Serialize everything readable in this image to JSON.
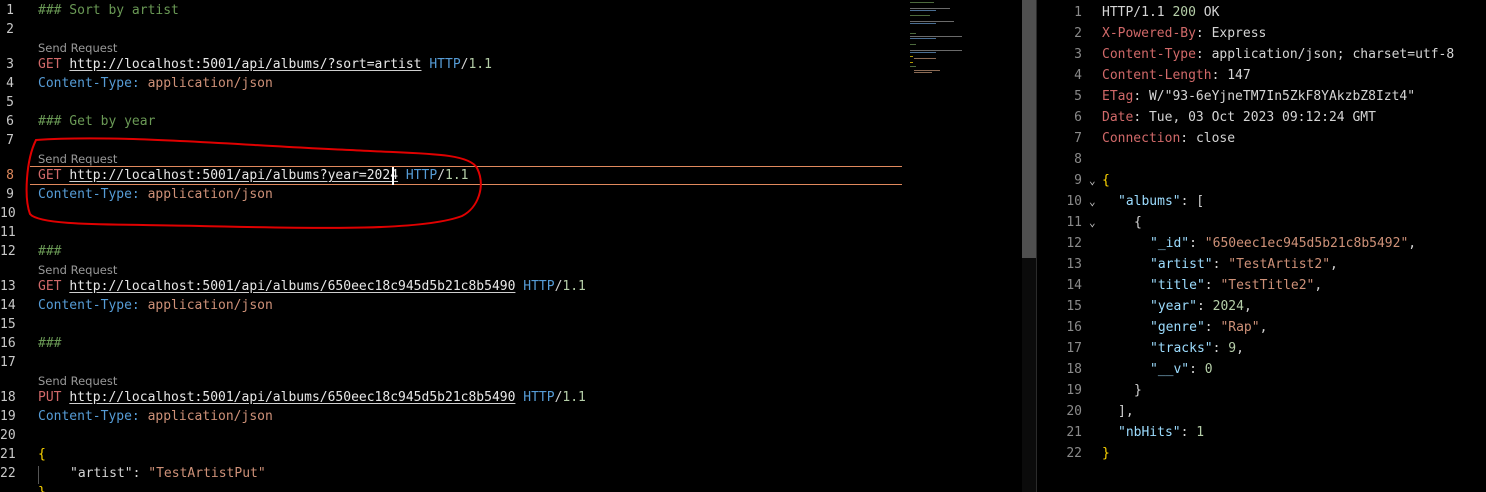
{
  "editor": {
    "code_lens": "Send Request",
    "blocks": {
      "l1": "### Sort by artist",
      "l3": {
        "method": "GET",
        "url": "http://localhost:5001/api/albums/?sort=artist",
        "proto": "HTTP",
        "slash": "/",
        "ver": "1.1"
      },
      "l4": {
        "key": "Content-Type:",
        "val": "application/json"
      },
      "l6": "### Get by year",
      "l8": {
        "method": "GET",
        "url": "http://localhost:5001/api/albums?year=2024",
        "proto": "HTTP",
        "slash": "/",
        "ver": "1.1"
      },
      "l9": {
        "key": "Content-Type:",
        "val": "application/json"
      },
      "l12": "###",
      "l13": {
        "method": "GET",
        "url": "http://localhost:5001/api/albums/650eec18c945d5b21c8b5490",
        "proto": "HTTP",
        "slash": "/",
        "ver": "1.1"
      },
      "l14": {
        "key": "Content-Type:",
        "val": "application/json"
      },
      "l16": "###",
      "l18": {
        "method": "PUT",
        "url": "http://localhost:5001/api/albums/650eec18c945d5b21c8b5490",
        "proto": "HTTP",
        "slash": "/",
        "ver": "1.1"
      },
      "l19": {
        "key": "Content-Type:",
        "val": "application/json"
      },
      "l21": "{",
      "l22": {
        "key": "\"artist\"",
        "colon": ": ",
        "val": "\"TestArtistPut\""
      },
      "l23": "}"
    },
    "line_numbers": [
      "1",
      "2",
      "3",
      "4",
      "5",
      "6",
      "7",
      "8",
      "9",
      "10",
      "11",
      "12",
      "13",
      "14",
      "15",
      "16",
      "17",
      "18",
      "19",
      "20",
      "21",
      "22"
    ],
    "active_line": "8",
    "colors": {
      "annotation": "#e00000",
      "current_line_border": "#e0895d",
      "background": "#000000"
    }
  },
  "response": {
    "status_line": {
      "proto": "HTTP/1.1 ",
      "code": "200",
      "text": " OK"
    },
    "headers": [
      {
        "name": "X-Powered-By",
        "value": "Express"
      },
      {
        "name": "Content-Type",
        "value": "application/json; charset=utf-8"
      },
      {
        "name": "Content-Length",
        "value": "147"
      },
      {
        "name": "ETag",
        "value": "W/\"93-6eYjneTM7In5ZkF8YAkzbZ8Izt4\""
      },
      {
        "name": "Date",
        "value": "Tue, 03 Oct 2023 09:12:24 GMT"
      },
      {
        "name": "Connection",
        "value": "close"
      }
    ],
    "body": {
      "open": "{",
      "albums_key": "\"albums\"",
      "albums_open": ": [",
      "item_open": "{",
      "fields": [
        {
          "k": "\"_id\"",
          "v": "\"650eec1ec945d5b21c8b5492\"",
          "t": "s",
          "comma": ","
        },
        {
          "k": "\"artist\"",
          "v": "\"TestArtist2\"",
          "t": "s",
          "comma": ","
        },
        {
          "k": "\"title\"",
          "v": "\"TestTitle2\"",
          "t": "s",
          "comma": ","
        },
        {
          "k": "\"year\"",
          "v": "2024",
          "t": "n",
          "comma": ","
        },
        {
          "k": "\"genre\"",
          "v": "\"Rap\"",
          "t": "s",
          "comma": ","
        },
        {
          "k": "\"tracks\"",
          "v": "9",
          "t": "n",
          "comma": ","
        },
        {
          "k": "\"__v\"",
          "v": "0",
          "t": "n",
          "comma": ""
        }
      ],
      "item_close": "}",
      "albums_close": "],",
      "nbhits_key": "\"nbHits\"",
      "nbhits_val": "1",
      "close": "}"
    },
    "line_numbers": [
      "1",
      "2",
      "3",
      "4",
      "5",
      "6",
      "7",
      "8",
      "9",
      "10",
      "11",
      "12",
      "13",
      "14",
      "15",
      "16",
      "17",
      "18",
      "19",
      "20",
      "21",
      "22"
    ],
    "fold_icon": "chevron-down-icon"
  }
}
